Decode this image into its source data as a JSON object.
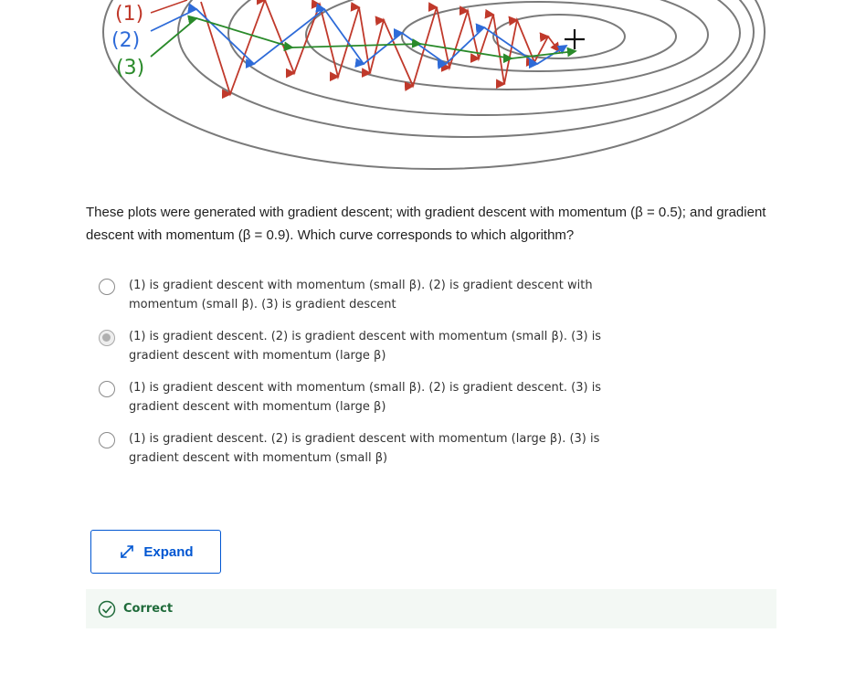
{
  "figure": {
    "labels": [
      "(1)",
      "(2)",
      "(3)"
    ],
    "label_colors": [
      "#c0392b",
      "#2e6bd8",
      "#2a8a2a"
    ],
    "contour_color": "#7a7a7a",
    "minimum_marker": "plus-icon"
  },
  "question": {
    "text": "These plots were generated with gradient descent; with gradient descent with momentum (β = 0.5); and gradient descent with momentum (β = 0.9). Which curve corresponds to which algorithm?"
  },
  "options": [
    {
      "text": "(1) is gradient descent with momentum (small β). (2) is gradient descent with momentum (small β). (3) is gradient descent",
      "selected": false
    },
    {
      "text": "(1) is gradient descent. (2) is gradient descent with momentum (small β). (3) is gradient descent with momentum (large β)",
      "selected": true
    },
    {
      "text": "(1) is gradient descent with momentum (small β). (2) is gradient descent. (3) is gradient descent with momentum (large β)",
      "selected": false
    },
    {
      "text": "(1) is gradient descent. (2) is gradient descent with momentum (large β). (3) is gradient descent with momentum (small β)",
      "selected": false
    }
  ],
  "expand": {
    "label": "Expand",
    "icon": "expand-arrows-icon"
  },
  "feedback": {
    "label": "Correct",
    "icon": "check-circle-icon",
    "color": "#1f6b3a"
  }
}
